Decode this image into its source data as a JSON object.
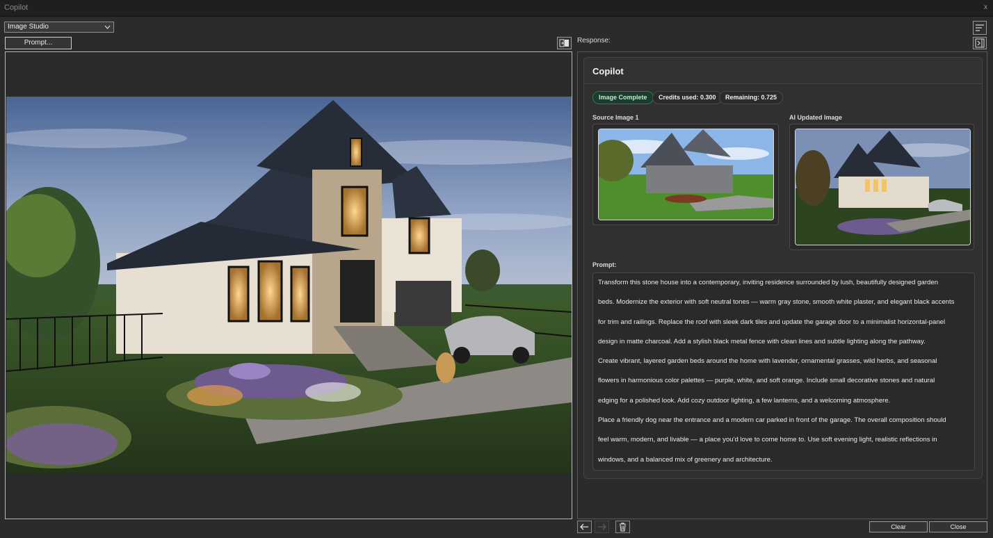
{
  "window": {
    "title": "Copilot",
    "close_glyph": "x"
  },
  "toolbar": {
    "mode_select": {
      "selected": "Image Studio"
    },
    "prompt_button": "Prompt...",
    "compare_icon": "split-compare-icon"
  },
  "response_panel": {
    "label": "Response:",
    "card_title": "Copilot",
    "status_badge": "Image Complete",
    "credits_used": "Credits used: 0.300",
    "remaining": "Remaining: 0.725",
    "source_label": "Source Image 1",
    "updated_label": "AI Updated Image",
    "prompt_label": "Prompt:",
    "prompt_lines": [
      "Transform this stone house into a contemporary, inviting residence surrounded by lush, beautifully designed garden",
      "beds. Modernize the exterior with soft neutral tones — warm gray stone, smooth white plaster, and elegant black accents",
      "for trim and railings. Replace the roof with sleek dark tiles and update the garage door to a minimalist horizontal-panel",
      "design in matte charcoal. Add a stylish black metal fence with clean lines and subtle lighting along the pathway.",
      "Create vibrant, layered garden beds around the home with lavender, ornamental grasses, wild herbs, and seasonal",
      "flowers in harmonious color palettes — purple, white, and soft orange. Include small decorative stones and natural",
      "edging for a polished look. Add cozy outdoor lighting, a few lanterns, and a welcoming atmosphere.",
      "Place a friendly dog near the entrance and a modern car parked in front of the garage. The overall composition should",
      "feel warm, modern, and livable — a place you'd love to come home to. Use soft evening light, realistic reflections in",
      "windows, and a balanced mix of greenery and architecture."
    ]
  },
  "bottom_bar": {
    "clear_label": "Clear",
    "close_label": "Close"
  },
  "colors": {
    "status_green": "#2f7a55",
    "panel_bg": "#2b2b2b",
    "titlebar_bg": "#1f1f1f"
  }
}
